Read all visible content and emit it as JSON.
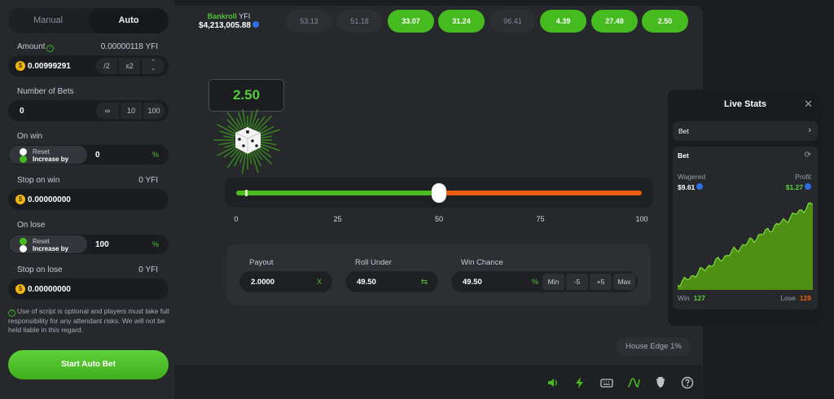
{
  "left_panel": {
    "tabs": {
      "manual": "Manual",
      "auto": "Auto"
    },
    "amount": {
      "label": "Amount",
      "info_icon": "info-icon",
      "max_value": "0.00000118 YFI",
      "value": "0.00999291",
      "half": "/2",
      "double": "x2"
    },
    "number_of_bets": {
      "label": "Number of Bets",
      "value": "0",
      "infinite": "∞",
      "ten": "10",
      "hundred": "100"
    },
    "on_win": {
      "label": "On win",
      "reset": "Reset",
      "increase": "Increase by",
      "value": "0",
      "suffix": "%"
    },
    "stop_on_win": {
      "label": "Stop on win",
      "unit": "0 YFI",
      "value": "0.00000000"
    },
    "on_lose": {
      "label": "On lose",
      "reset": "Reset",
      "increase": "Increase by",
      "value": "100",
      "suffix": "%"
    },
    "stop_on_lose": {
      "label": "Stop on lose",
      "unit": "0 YFI",
      "value": "0.00000000"
    },
    "disclaimer": "Use of script is optional and players must take full responsibility for any attendant risks. We will not be held liable in this regard.",
    "start_button": "Start Auto Bet",
    "colors": {
      "accent": "#46bb1f",
      "coin": "#f0b90b"
    }
  },
  "top_bar": {
    "bankroll_label": "Bankroll",
    "bankroll_currency": "YFI",
    "bankroll_value": "$4,213,005.88",
    "history": [
      {
        "value": "53.13",
        "result": "loss"
      },
      {
        "value": "51.18",
        "result": "loss"
      },
      {
        "value": "33.07",
        "result": "win"
      },
      {
        "value": "31.24",
        "result": "win"
      },
      {
        "value": "96.41",
        "result": "loss"
      },
      {
        "value": "4.39",
        "result": "win"
      },
      {
        "value": "27.48",
        "result": "win"
      },
      {
        "value": "2.50",
        "result": "win"
      }
    ]
  },
  "game": {
    "result": "2.50",
    "dice_icon": "dice-icon",
    "slider": {
      "value": 50,
      "last_roll": 2.5,
      "min": 0,
      "max": 100,
      "ticks": [
        "0",
        "25",
        "50",
        "75",
        "100"
      ],
      "under_color": "#4dbb22",
      "over_color": "#ec5d10"
    },
    "payout": {
      "label": "Payout",
      "value": "2.0000",
      "suffix": "X"
    },
    "roll_under": {
      "label": "Roll Under",
      "value": "49.50",
      "swap_icon": "swap-icon"
    },
    "win_chance": {
      "label": "Win Chance",
      "value": "49.50",
      "suffix": "%",
      "min": "Min",
      "minus5": "-5",
      "plus5": "+5",
      "max": "Max"
    },
    "house_edge": "House Edge 1%",
    "bottom_icons": [
      "sound-icon",
      "lightning-icon",
      "keyboard-icon",
      "stats-chart-icon",
      "fairness-icon",
      "help-icon"
    ]
  },
  "live_stats": {
    "title": "Live Stats",
    "select_label": "Bet",
    "card_title": "Bet",
    "wagered_label": "Wagered",
    "wagered_value": "$9.61",
    "profit_label": "Profit",
    "profit_value": "$1.27",
    "win_label": "Win",
    "win_count": "127",
    "lose_label": "Lose",
    "lose_count": "129",
    "chart_color": "#4f8f14",
    "chart_line": "#7fe03b"
  }
}
